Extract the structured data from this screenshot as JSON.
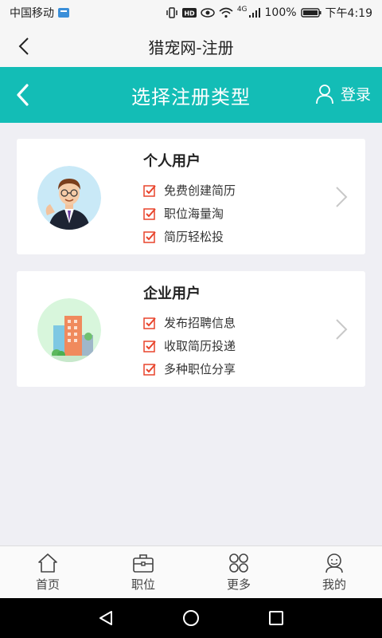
{
  "status_bar": {
    "carrier": "中国移动",
    "network": "4G",
    "battery": "100%",
    "time": "下午4:19"
  },
  "web_bar": {
    "title": "猎宠网-注册"
  },
  "header": {
    "title": "选择注册类型",
    "login_label": "登录"
  },
  "cards": {
    "personal": {
      "title": "个人用户",
      "features": [
        "免费创建简历",
        "职位海量淘",
        "简历轻松投"
      ]
    },
    "company": {
      "title": "企业用户",
      "features": [
        "发布招聘信息",
        "收取简历投递",
        "多种职位分享"
      ]
    }
  },
  "tabbar": {
    "items": [
      {
        "label": "首页",
        "icon": "home-icon"
      },
      {
        "label": "职位",
        "icon": "briefcase-icon"
      },
      {
        "label": "更多",
        "icon": "more-icon"
      },
      {
        "label": "我的",
        "icon": "profile-icon"
      }
    ]
  },
  "colors": {
    "accent": "#13bdb6",
    "check": "#e8442c"
  }
}
